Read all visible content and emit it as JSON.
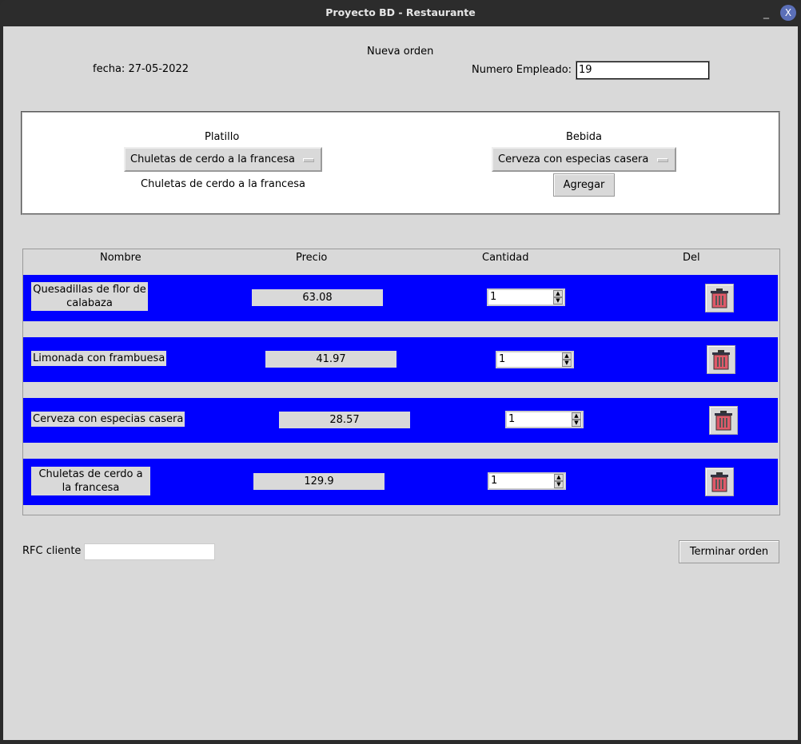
{
  "window": {
    "title": "Proyecto BD - Restaurante",
    "minimize": "_",
    "close": "X"
  },
  "header": {
    "title": "Nueva orden",
    "fecha": "fecha: 27-05-2022",
    "empleado_label": "Numero Empleado:",
    "empleado_value": "19"
  },
  "selector": {
    "platillo_label": "Platillo",
    "platillo_value": "Chuletas de cerdo a la francesa",
    "platillo_selected_text": "Chuletas de cerdo a la francesa",
    "bebida_label": "Bebida",
    "bebida_value": "Cerveza con especias casera",
    "add_button": "Agregar"
  },
  "table": {
    "headers": [
      "Nombre",
      "Precio",
      "Cantidad",
      "Del"
    ],
    "rows": [
      {
        "name": "Quesadillas de flor de calabaza",
        "price": "63.08",
        "qty": "1"
      },
      {
        "name": "Limonada con frambuesa",
        "price": "41.97",
        "qty": "1"
      },
      {
        "name": "Cerveza con especias casera",
        "price": "28.57",
        "qty": "1"
      },
      {
        "name": "Chuletas de cerdo a la francesa",
        "price": "129.9",
        "qty": "1"
      }
    ]
  },
  "footer": {
    "rfc_label": "RFC cliente",
    "rfc_value": "",
    "finish_button": "Terminar orden"
  },
  "colors": {
    "row_bg": "#0000ff",
    "window_bg": "#d9d9d9"
  }
}
